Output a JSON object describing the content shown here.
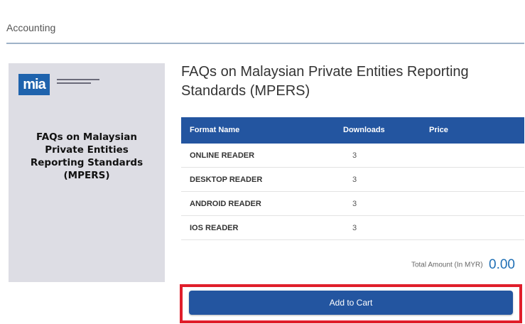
{
  "breadcrumb": {
    "category": "Accounting"
  },
  "cover": {
    "logo_text": "mia",
    "title_lines": [
      "FAQs on Malaysian",
      "Private Entities",
      "Reporting Standards",
      "(MPERS)"
    ]
  },
  "product": {
    "title": "FAQs on Malaysian Private Entities Reporting Standards (MPERS)"
  },
  "table": {
    "headers": {
      "format": "Format Name",
      "downloads": "Downloads",
      "price": "Price"
    },
    "rows": [
      {
        "format": "ONLINE READER",
        "downloads": "3",
        "price": ""
      },
      {
        "format": "DESKTOP READER",
        "downloads": "3",
        "price": ""
      },
      {
        "format": "ANDROID READER",
        "downloads": "3",
        "price": ""
      },
      {
        "format": "IOS READER",
        "downloads": "3",
        "price": ""
      }
    ]
  },
  "total": {
    "label": "Total Amount (In MYR)",
    "amount": "0.00"
  },
  "cart": {
    "button_label": "Add to Cart"
  },
  "colors": {
    "header_blue": "#2355a0",
    "highlight_red": "#e01e2b",
    "amount_blue": "#1f6fb5",
    "cover_bg": "#dddde4"
  }
}
